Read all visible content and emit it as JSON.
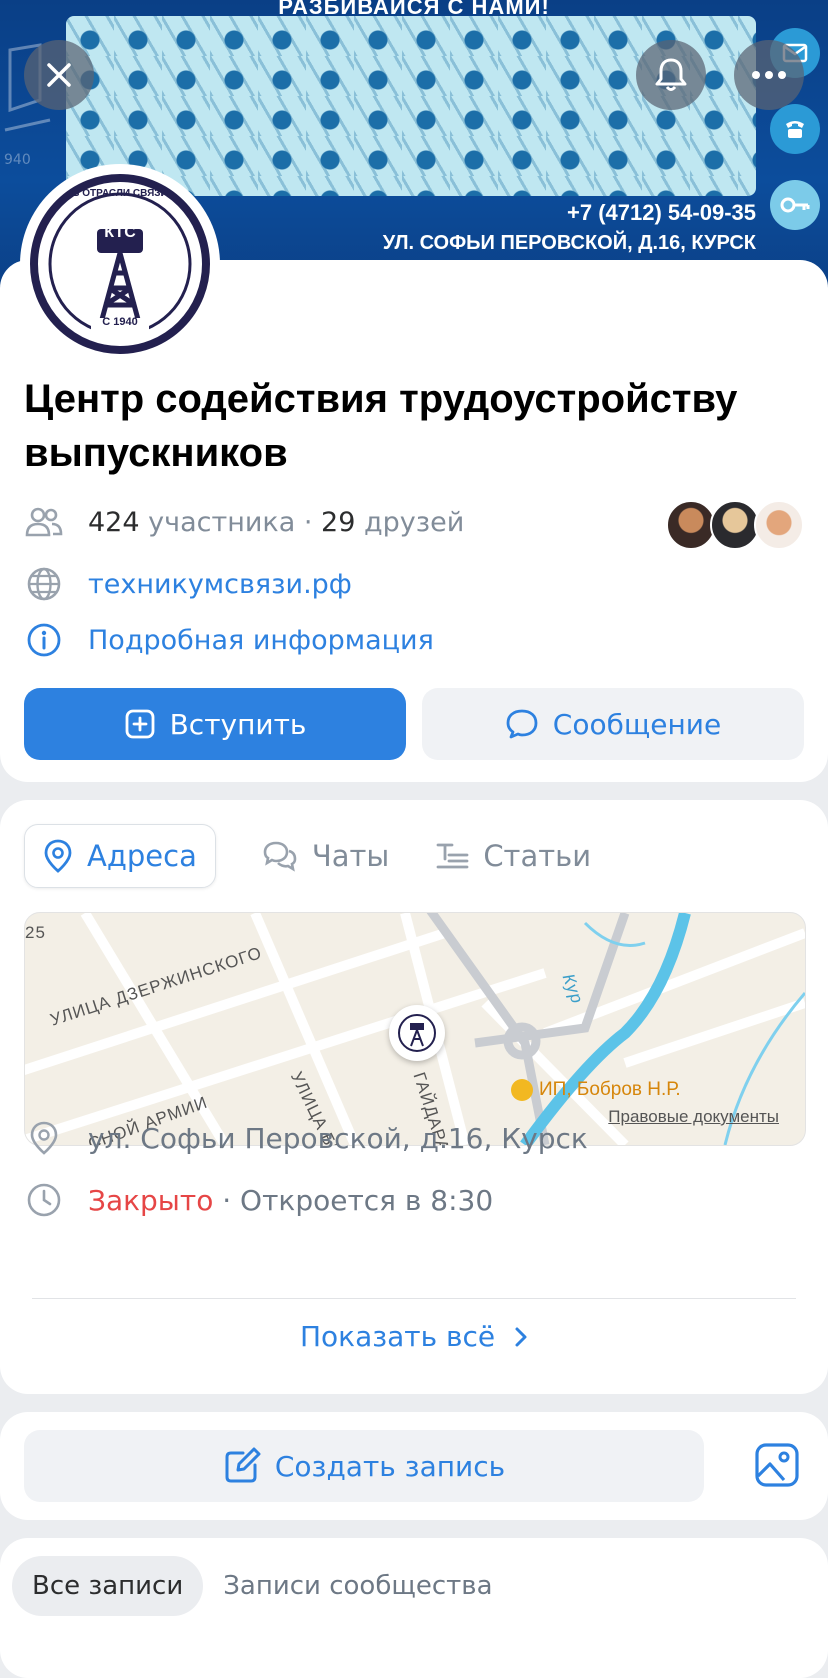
{
  "cover": {
    "top_text": "РАЗБИВАЙСЯ С НАМИ!",
    "phone": "+7 (4712) 54-09-35",
    "address": "УЛ. СОФЬИ ПЕРОВСКОЙ, Д.16, КУРСК",
    "deco_year": "940"
  },
  "logo": {
    "ring_text": "В ОТРАСЛИ СВЯЗИ",
    "abbr": "КТС",
    "year": "С 1940"
  },
  "group": {
    "title": "Центр содействия трудоустройству выпускников",
    "members_count": "424",
    "members_label": "участника",
    "separator": "·",
    "friends_count": "29",
    "friends_label": "друзей",
    "website": "техникумсвязи.рф",
    "details": "Подробная информация"
  },
  "actions": {
    "join": "Вступить",
    "message": "Сообщение"
  },
  "tabs": {
    "addresses": "Адреса",
    "chats": "Чаты",
    "articles": "Статьи"
  },
  "map": {
    "house_number": "25",
    "street_1": "УЛИЦА ДЗЕРЖИНСКОГО",
    "street_2": "УЛИЦА БЕЛИНСКОГО",
    "street_3": "ГАЙДАРА",
    "street_4": "СНОЙ АРМИИ",
    "river": "Кур",
    "poi": "ИП, Бобров Н.Р.",
    "legal": "Правовые документы"
  },
  "address": {
    "text": "ул. Софьи Перовской, д.16, Курск",
    "status": "Закрыто",
    "opens": "· Откроется в 8:30",
    "show_all": "Показать всё"
  },
  "post": {
    "create": "Создать запись"
  },
  "wall": {
    "all": "Все записи",
    "community": "Записи сообщества"
  },
  "colors": {
    "accent": "#2d81e0",
    "closed": "#e64646",
    "muted": "#818c99"
  }
}
